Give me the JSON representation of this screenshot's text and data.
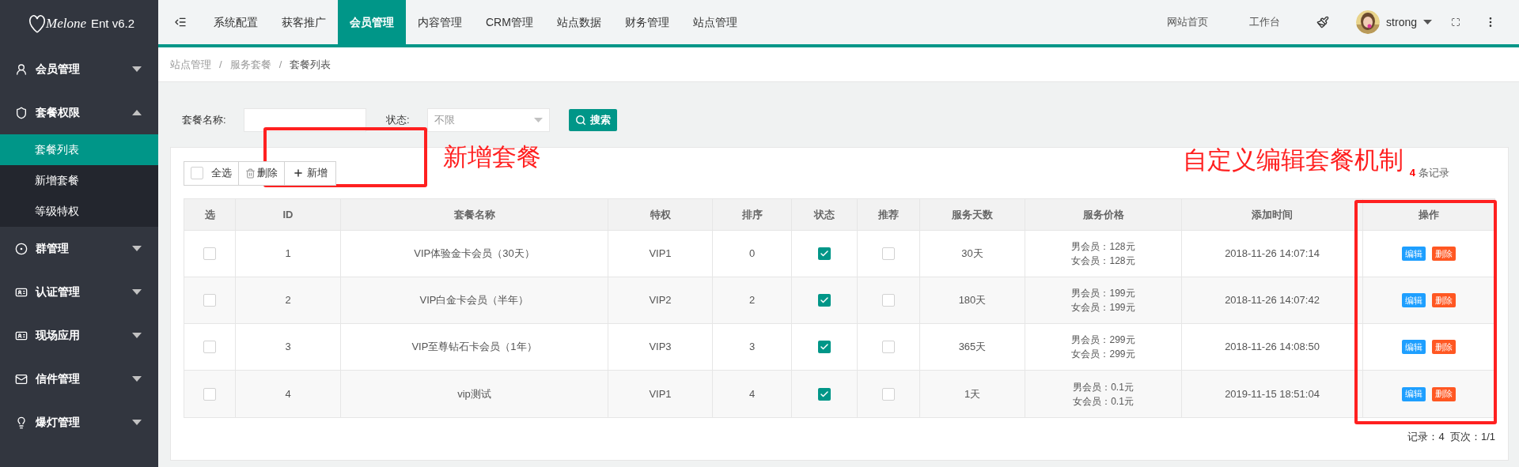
{
  "logo": {
    "script": "Melone",
    "edition": "Ent v6.2"
  },
  "top_nav": [
    {
      "label": "系统配置",
      "selected": false
    },
    {
      "label": "获客推广",
      "selected": false
    },
    {
      "label": "会员管理",
      "selected": true
    },
    {
      "label": "内容管理",
      "selected": false
    },
    {
      "label": "CRM管理",
      "selected": false
    },
    {
      "label": "站点数据",
      "selected": false
    },
    {
      "label": "财务管理",
      "selected": false
    },
    {
      "label": "站点管理",
      "selected": false
    }
  ],
  "header_links": [
    "网站首页",
    "工作台"
  ],
  "user": {
    "name": "strong"
  },
  "sidebar": {
    "items": [
      {
        "label": "会员管理",
        "expanded": false
      },
      {
        "label": "套餐权限",
        "expanded": true,
        "children": [
          {
            "label": "套餐列表",
            "selected": true
          },
          {
            "label": "新增套餐",
            "selected": false
          },
          {
            "label": "等级特权",
            "selected": false
          }
        ]
      },
      {
        "label": "群管理",
        "expanded": false
      },
      {
        "label": "认证管理",
        "expanded": false
      },
      {
        "label": "现场应用",
        "expanded": false
      },
      {
        "label": "信件管理",
        "expanded": false
      },
      {
        "label": "爆灯管理",
        "expanded": false
      }
    ]
  },
  "breadcrumb": {
    "separator": "/",
    "items": [
      "站点管理",
      "服务套餐",
      "套餐列表"
    ]
  },
  "filters": {
    "name_label": "套餐名称:",
    "status_label": "状态:",
    "status_value": "不限",
    "search_button": "搜索"
  },
  "toolbar": {
    "select_all": {
      "label": "全选",
      "checked": false
    },
    "delete": "删除",
    "add": "新增"
  },
  "record_count": {
    "count": "4",
    "suffix": "条记录"
  },
  "table": {
    "columns": [
      "选",
      "ID",
      "套餐名称",
      "特权",
      "排序",
      "状态",
      "推荐",
      "服务天数",
      "服务价格",
      "添加时间",
      "操作"
    ],
    "rows": [
      {
        "selected": false,
        "id": "1",
        "name": "VIP体验金卡会员（30天）",
        "privilege": "VIP1",
        "order": "0",
        "status": true,
        "recommended": false,
        "days": "30天",
        "prices": [
          "男会员：128元",
          "女会员：128元"
        ],
        "added": "2018-11-26 14:07:14",
        "actions": [
          "编辑",
          "删除"
        ]
      },
      {
        "selected": false,
        "id": "2",
        "name": "VIP白金卡会员（半年）",
        "privilege": "VIP2",
        "order": "2",
        "status": true,
        "recommended": false,
        "days": "180天",
        "prices": [
          "男会员：199元",
          "女会员：199元"
        ],
        "added": "2018-11-26 14:07:42",
        "actions": [
          "编辑",
          "删除"
        ]
      },
      {
        "selected": false,
        "id": "3",
        "name": "VIP至尊钻石卡会员（1年）",
        "privilege": "VIP3",
        "order": "3",
        "status": true,
        "recommended": false,
        "days": "365天",
        "prices": [
          "男会员：299元",
          "女会员：299元"
        ],
        "added": "2018-11-26 14:08:50",
        "actions": [
          "编辑",
          "删除"
        ]
      },
      {
        "selected": false,
        "id": "4",
        "name": "vip测试",
        "privilege": "VIP1",
        "order": "4",
        "status": true,
        "recommended": false,
        "days": "1天",
        "prices": [
          "男会员：0.1元",
          "女会员：0.1元"
        ],
        "added": "2019-11-15 18:51:04",
        "actions": [
          "编辑",
          "删除"
        ]
      }
    ]
  },
  "pagination": "记录：4  页次：1/1",
  "annotations": [
    "新增套餐",
    "自定义编辑套餐机制"
  ]
}
